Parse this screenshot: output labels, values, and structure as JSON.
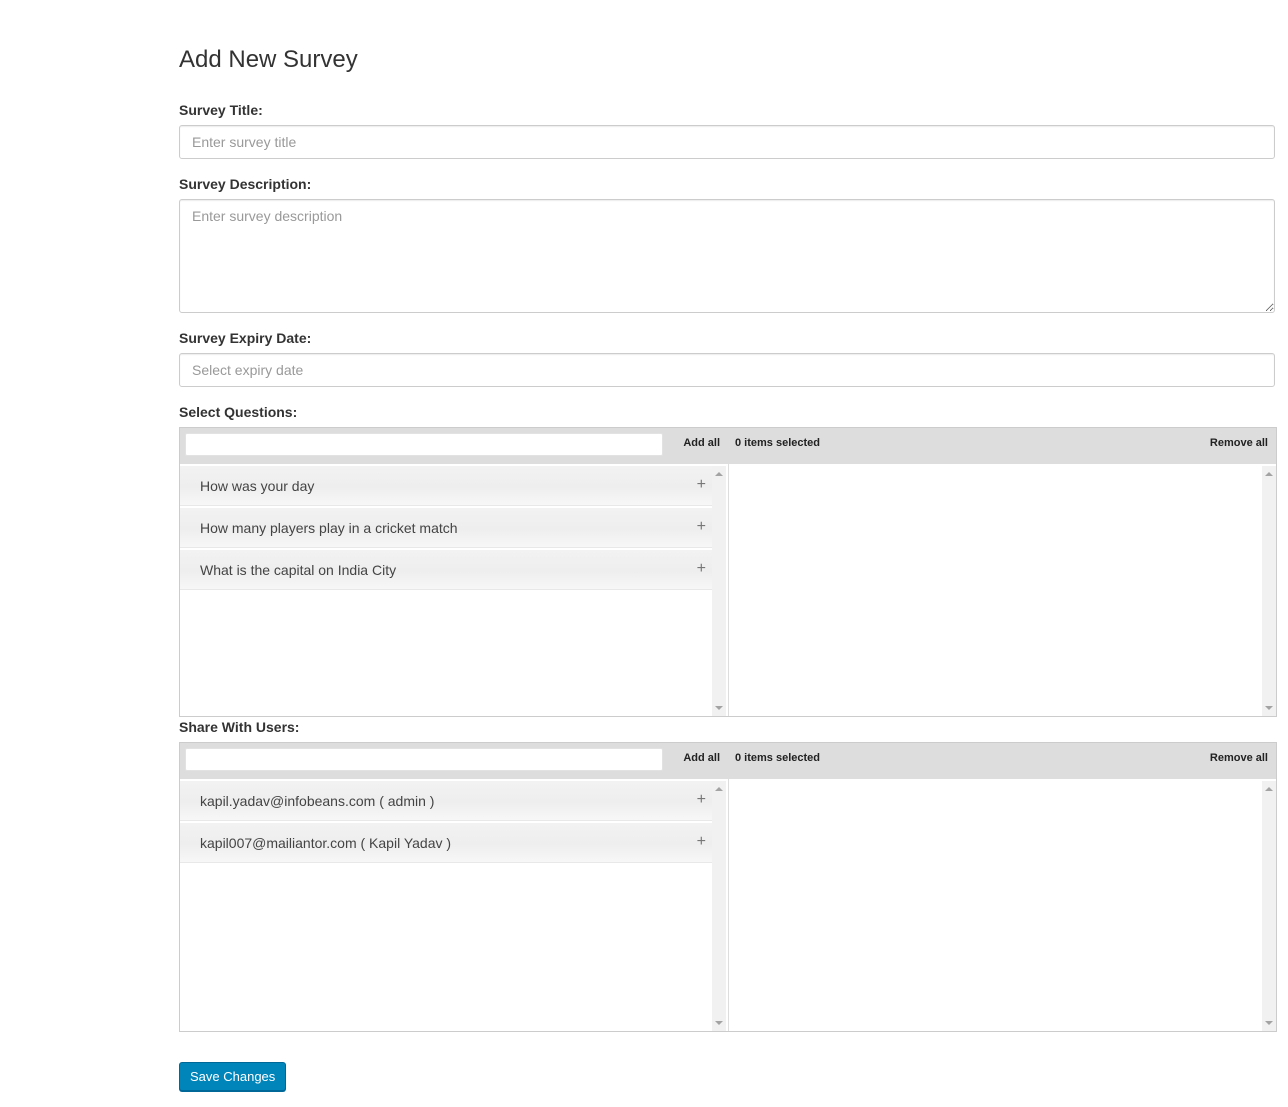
{
  "page": {
    "title": "Add New Survey"
  },
  "form": {
    "title_label": "Survey Title:",
    "title_placeholder": "Enter survey title",
    "title_value": "",
    "description_label": "Survey Description:",
    "description_placeholder": "Enter survey description",
    "description_value": "",
    "expiry_label": "Survey Expiry Date:",
    "expiry_placeholder": "Select expiry date",
    "expiry_value": ""
  },
  "questions": {
    "label": "Select Questions:",
    "add_all": "Add all",
    "selected_count": "0 items selected",
    "remove_all": "Remove all",
    "items": [
      {
        "label": "How was your day",
        "action": "+"
      },
      {
        "label": "How many players play in a cricket match",
        "action": "+"
      },
      {
        "label": "What is the capital on India City",
        "action": "+"
      }
    ]
  },
  "users": {
    "label": "Share With Users:",
    "add_all": "Add all",
    "selected_count": "0 items selected",
    "remove_all": "Remove all",
    "items": [
      {
        "label": "kapil.yadav@infobeans.com ( admin )",
        "action": "+"
      },
      {
        "label": "kapil007@mailiantor.com ( Kapil Yadav )",
        "action": "+"
      }
    ]
  },
  "actions": {
    "save_label": "Save Changes"
  },
  "colors": {
    "primary_button": "#0085ba",
    "header_bar": "#dddddd"
  }
}
